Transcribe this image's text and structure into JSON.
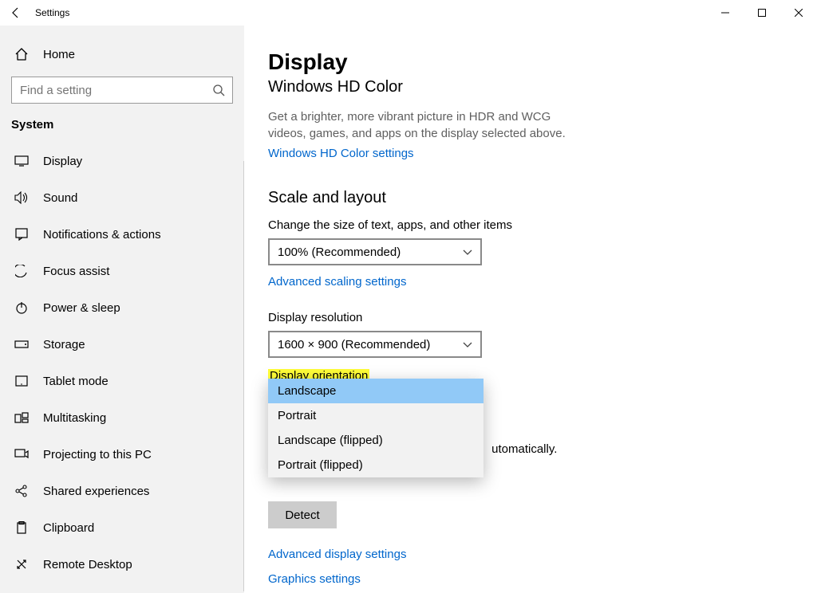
{
  "window": {
    "title": "Settings"
  },
  "sidebar": {
    "home": "Home",
    "search_placeholder": "Find a setting",
    "category": "System",
    "items": [
      "Display",
      "Sound",
      "Notifications & actions",
      "Focus assist",
      "Power & sleep",
      "Storage",
      "Tablet mode",
      "Multitasking",
      "Projecting to this PC",
      "Shared experiences",
      "Clipboard",
      "Remote Desktop"
    ]
  },
  "main": {
    "title": "Display",
    "subtitle": "Windows HD Color",
    "hd_desc": "Get a brighter, more vibrant picture in HDR and WCG videos, games, and apps on the display selected above.",
    "hd_link": "Windows HD Color settings",
    "scale_heading": "Scale and layout",
    "scale_label": "Change the size of text, apps, and other items",
    "scale_value": "100% (Recommended)",
    "adv_scaling_link": "Advanced scaling settings",
    "resolution_label": "Display resolution",
    "resolution_value": "1600 × 900 (Recommended)",
    "orientation_label": "Display orientation",
    "orientation_options": [
      "Landscape",
      "Portrait",
      "Landscape (flipped)",
      "Portrait (flipped)"
    ],
    "orientation_selected": "Landscape",
    "detect_para_tail": "utomatically. Select Detect to try to connect to them.",
    "detect_button": "Detect",
    "adv_display_link": "Advanced display settings",
    "graphics_link": "Graphics settings"
  }
}
